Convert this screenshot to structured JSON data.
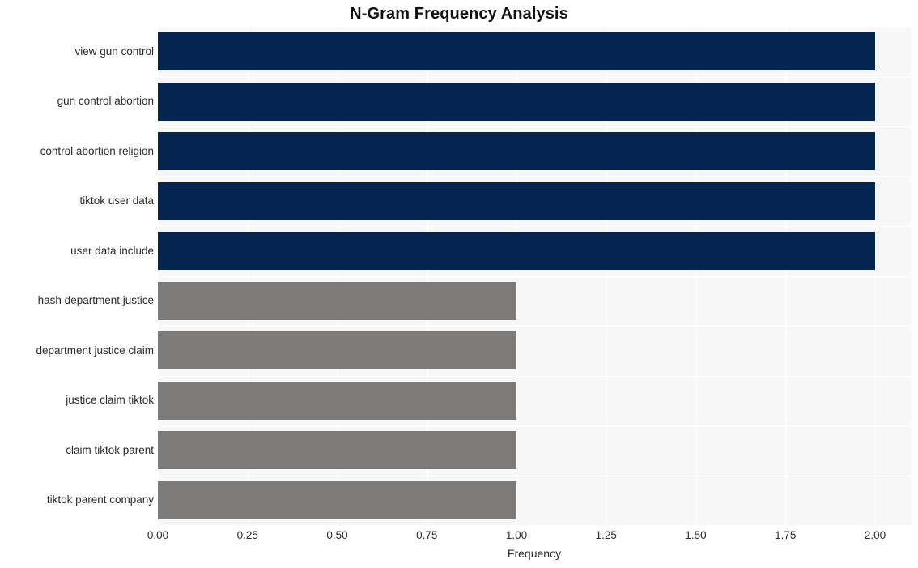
{
  "chart_data": {
    "type": "bar",
    "orientation": "horizontal",
    "title": "N-Gram Frequency Analysis",
    "xlabel": "Frequency",
    "ylabel": "",
    "xlim": [
      0,
      2
    ],
    "xticks": [
      "0.00",
      "0.25",
      "0.50",
      "0.75",
      "1.00",
      "1.25",
      "1.50",
      "1.75",
      "2.00"
    ],
    "xtick_values": [
      0,
      0.25,
      0.5,
      0.75,
      1.0,
      1.25,
      1.5,
      1.75,
      2.0
    ],
    "grid": true,
    "legend": "none",
    "categories": [
      "view gun control",
      "gun control abortion",
      "control abortion religion",
      "tiktok user data",
      "user data include",
      "hash department justice",
      "department justice claim",
      "justice claim tiktok",
      "claim tiktok parent",
      "tiktok parent company"
    ],
    "values": [
      2,
      2,
      2,
      2,
      2,
      1,
      1,
      1,
      1,
      1
    ],
    "bar_colors": [
      "#04254f",
      "#04254f",
      "#04254f",
      "#04254f",
      "#04254f",
      "#7d7b7a",
      "#7d7b7a",
      "#7d7b7a",
      "#7d7b7a",
      "#7d7b7a"
    ]
  },
  "style": {
    "plot_background": "#f7f7f7",
    "figure_background": "#ffffff",
    "grid_color": "#ffffff",
    "text_color": "#2b2b2b",
    "title_color": "#111111"
  }
}
